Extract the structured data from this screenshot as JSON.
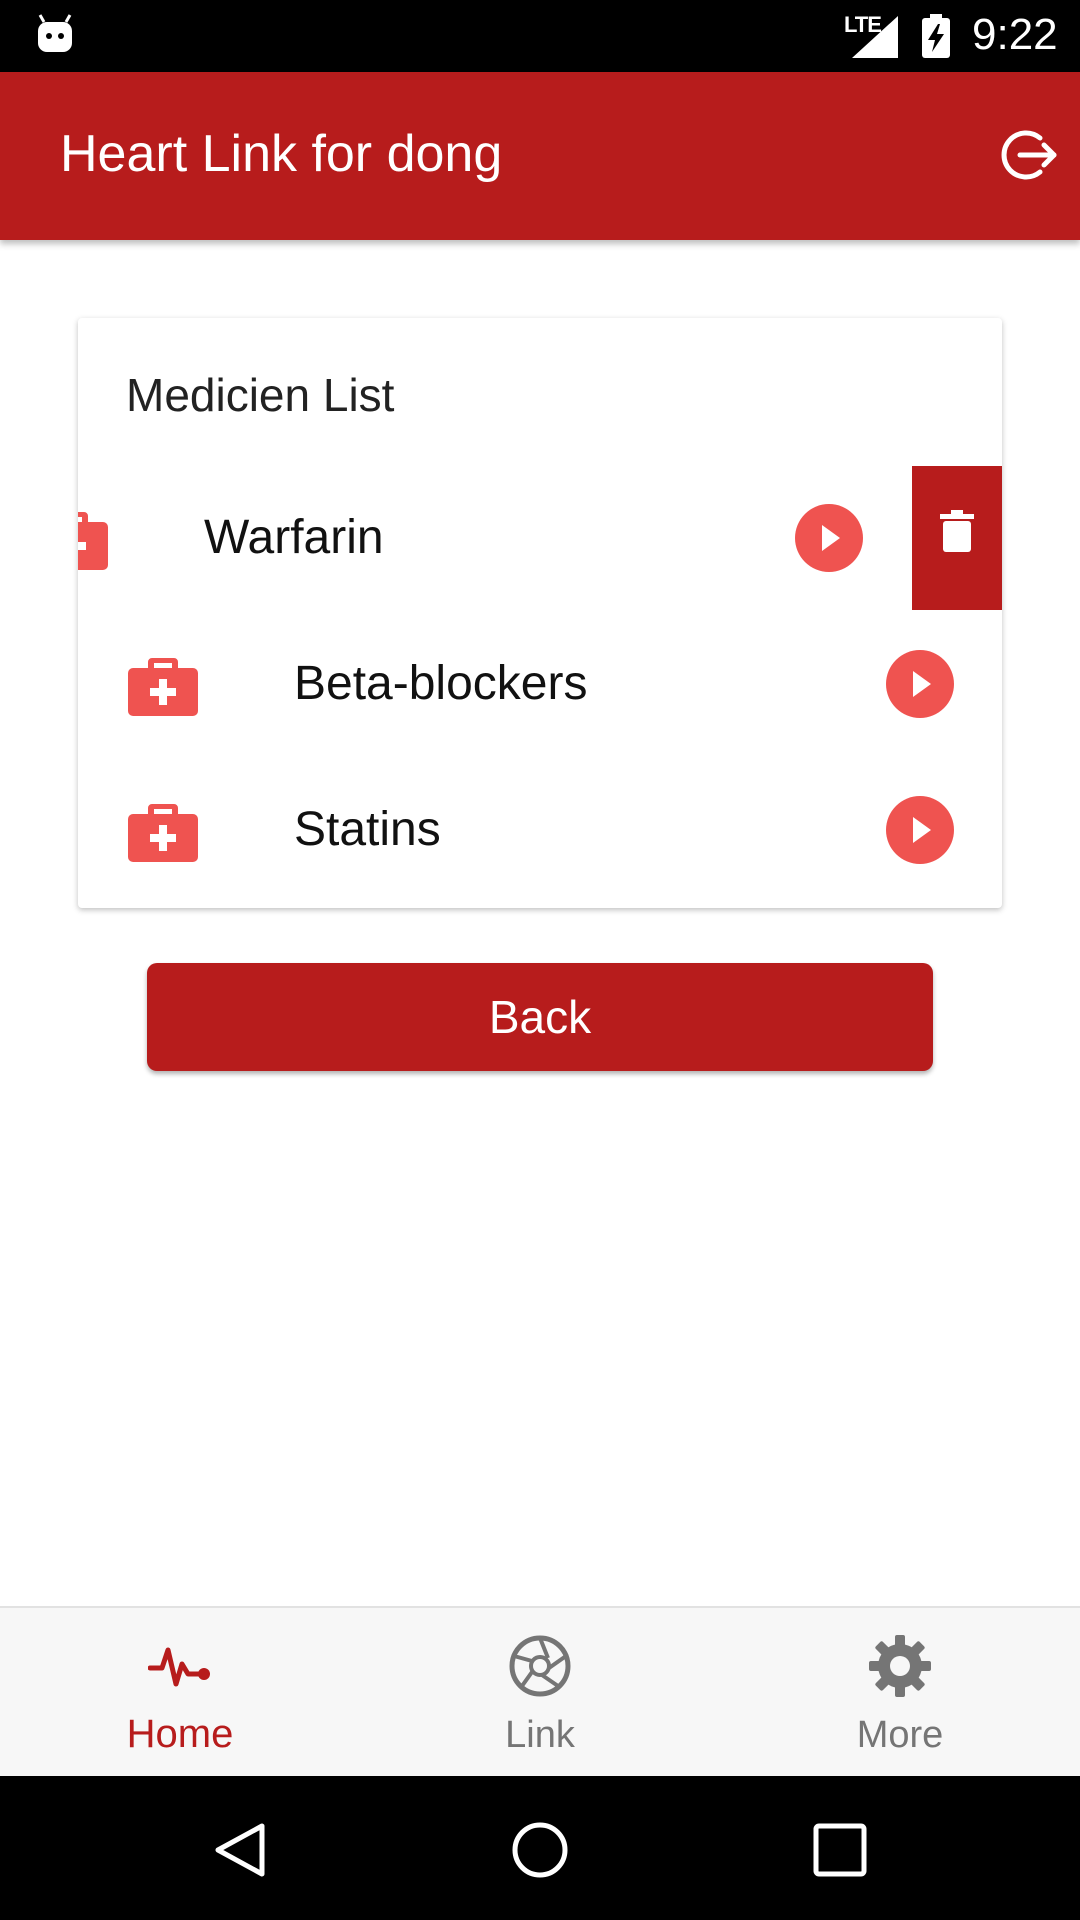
{
  "status_bar": {
    "network": "LTE",
    "time": "9:22"
  },
  "app_bar": {
    "title": "Heart Link for dong"
  },
  "card": {
    "title": "Medicien List",
    "items": [
      {
        "label": "Warfarin",
        "swiped": true
      },
      {
        "label": "Beta-blockers"
      },
      {
        "label": "Statins"
      }
    ]
  },
  "back_button": {
    "label": "Back"
  },
  "bottom_nav": {
    "items": [
      {
        "label": "Home",
        "active": true
      },
      {
        "label": "Link"
      },
      {
        "label": "More"
      }
    ]
  },
  "colors": {
    "primary": "#B71C1C",
    "accent": "#EF5350",
    "inactive": "#757575"
  },
  "icons": {
    "robot": "android-notification-icon",
    "signal": "signal-icon",
    "battery": "battery-charging-icon",
    "logout": "logout-icon",
    "medicine": "medical-kit-icon",
    "play": "play-circle-icon",
    "delete": "trash-icon",
    "home": "heartbeat-icon",
    "link": "aperture-icon",
    "more": "gear-icon"
  }
}
